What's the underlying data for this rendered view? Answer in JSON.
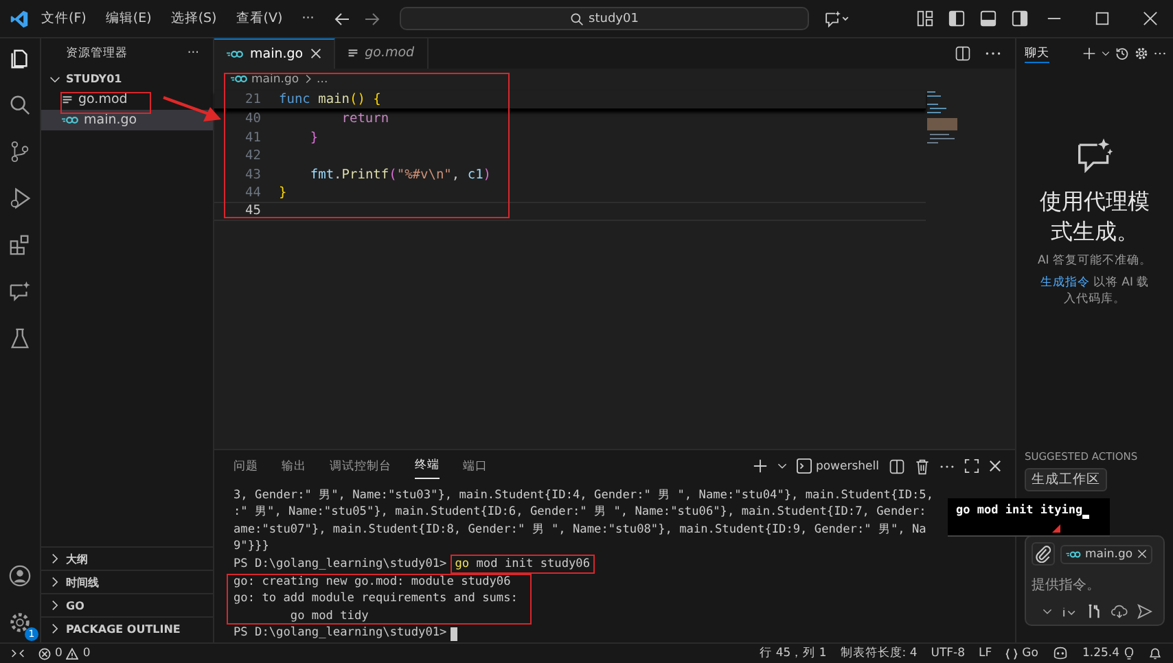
{
  "menu": [
    {
      "label": "文件(F)"
    },
    {
      "label": "编辑(E)"
    },
    {
      "label": "选择(S)"
    },
    {
      "label": "查看(V)"
    },
    {
      "label": "···"
    }
  ],
  "search": {
    "value": "study01"
  },
  "explorer": {
    "title": "资源管理器",
    "more": "···",
    "folder": {
      "name": "STUDY01",
      "expanded": true
    },
    "files": [
      {
        "name": "go.mod",
        "kind": "mod",
        "selected": false
      },
      {
        "name": "main.go",
        "kind": "go",
        "selected": true
      }
    ],
    "sections": [
      {
        "name": "大纲",
        "expanded": false
      },
      {
        "name": "时间线",
        "expanded": false
      },
      {
        "name": "GO",
        "expanded": false
      },
      {
        "name": "PACKAGE OUTLINE",
        "expanded": false
      }
    ]
  },
  "editor": {
    "tabs": [
      {
        "name": "main.go",
        "kind": "go",
        "selected": true,
        "preview": false
      },
      {
        "name": "go.mod",
        "kind": "mod",
        "selected": false,
        "preview": true
      }
    ],
    "breadcrumb": {
      "file": "main.go",
      "rest": "..."
    },
    "sticky": {
      "number": "21",
      "segments": [
        {
          "text": "func ",
          "kind": "keyword"
        },
        {
          "text": "main",
          "kind": "fn"
        },
        {
          "text": "() {",
          "kind": "bracket1"
        }
      ]
    },
    "lines": [
      {
        "number": "40",
        "current": false,
        "segments": [
          {
            "text": "        return",
            "kind": "control"
          }
        ]
      },
      {
        "number": "41",
        "current": false,
        "segments": [
          {
            "text": "    }",
            "kind": "bracket2"
          }
        ]
      },
      {
        "number": "42",
        "current": false
      },
      {
        "number": "43",
        "current": false,
        "segments": [
          {
            "text": "    fmt",
            "kind": "var"
          },
          {
            "text": ".",
            "kind": "plain"
          },
          {
            "text": "Printf",
            "kind": "fn"
          },
          {
            "text": "(",
            "kind": "bracket2"
          },
          {
            "text": "\"%#v\\n\"",
            "kind": "str"
          },
          {
            "text": ", ",
            "kind": "plain"
          },
          {
            "text": "c1",
            "kind": "var"
          },
          {
            "text": ")",
            "kind": "bracket2"
          }
        ]
      },
      {
        "number": "44",
        "current": false,
        "segments": [
          {
            "text": "}",
            "kind": "bracket1"
          }
        ]
      },
      {
        "number": "45",
        "current": true
      }
    ]
  },
  "panel": {
    "tabs": [
      {
        "label": "问题",
        "selected": false
      },
      {
        "label": "输出",
        "selected": false
      },
      {
        "label": "调试控制台",
        "selected": false
      },
      {
        "label": "终端",
        "selected": true
      },
      {
        "label": "端口",
        "selected": false
      }
    ],
    "shell": "powershell",
    "terminal": [
      {
        "kind": "output",
        "text": "3, Gender:\" 男\", Name:\"stu03\"}, main.Student{ID:4, Gender:\" 男 \", Name:\"stu04\"}, main.Student{ID:5,"
      },
      {
        "kind": "output",
        "text": ":\" 男\", Name:\"stu05\"}, main.Student{ID:6, Gender:\" 男 \", Name:\"stu06\"}, main.Student{ID:7, Gender:"
      },
      {
        "kind": "output",
        "text": "ame:\"stu07\"}, main.Student{ID:8, Gender:\" 男 \", Name:\"stu08\"}, main.Student{ID:9, Gender:\" 男\", Na"
      },
      {
        "kind": "output",
        "text": "9\"}}}"
      },
      {
        "kind": "prompt",
        "prompt": "PS D:\\golang_learning\\study01>",
        "command": [
          {
            "text": "go",
            "kind": "exe"
          },
          {
            "text": " mod init study06",
            "kind": "arg"
          }
        ],
        "cursor": false
      },
      {
        "kind": "output",
        "text": "go: creating new go.mod: module study06"
      },
      {
        "kind": "output",
        "text": "go: to add module requirements and sums:"
      },
      {
        "kind": "output",
        "text": "        go mod tidy"
      },
      {
        "kind": "prompt",
        "prompt": "PS D:\\golang_learning\\study01>",
        "cursor": true
      }
    ]
  },
  "activity": {
    "settings_badge": "1"
  },
  "popup": {
    "text": "go mod init itying"
  },
  "chat": {
    "tab": "聊天",
    "heading": "使用代理模式生成。",
    "note": "AI 答复可能不准确。",
    "hint": {
      "link": "生成指令",
      "text": " 以将 AI 载入代码库。"
    },
    "suggested_title": "SUGGESTED ACTIONS",
    "actions": [
      "生成工作区"
    ],
    "attachment": "main.go",
    "placeholder": "提供指令。"
  },
  "status": {
    "errors": "0",
    "warnings": "0",
    "position": "行 45，列 1",
    "tab_size": "制表符长度: 4",
    "encoding": "UTF-8",
    "eol": "LF",
    "language": "Go",
    "version": "1.25.4"
  }
}
